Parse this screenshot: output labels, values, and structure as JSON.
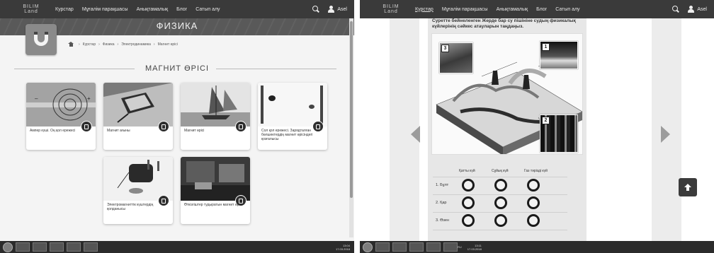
{
  "left": {
    "nav": {
      "logo_line1": "BILIM",
      "logo_line2": "Land",
      "links": [
        "Курстар",
        "Мұғалім парақшасы",
        "Анықтамалық",
        "Блог",
        "Сатып алу"
      ],
      "search_icon": "search-icon",
      "user_icon": "user-icon",
      "username": "Asel"
    },
    "banner_title": "ФИЗИКА",
    "subject_icon": "magnet-icon",
    "breadcrumb": [
      "Курстар",
      "Физика",
      "Электродинамика",
      "Магнит өрісі"
    ],
    "section_title": "МАГНИТ ӨРІСІ",
    "cards": [
      {
        "label": "Ампер күші. Оң қол ережесі",
        "image": "wire-coil-field"
      },
      {
        "label": "Магнит ағыны",
        "image": "frame-in-field"
      },
      {
        "label": "Магнит өрісі",
        "image": "sailboats"
      },
      {
        "label": "Сол қол ережесі. Зарядталған бөлшектердің магнит өрісіндегі қозғалысы",
        "image": "charged-particles"
      },
      {
        "label": "Электромагниттік күштердің қолданысы",
        "image": "electromagnet-device"
      },
      {
        "label": "Өткізгіштер тудыратын магнит өрісі",
        "image": "conductor-lab"
      }
    ]
  },
  "right": {
    "nav": {
      "logo_line1": "BILIM",
      "logo_line2": "Land",
      "links": [
        "Курстар",
        "Мұғалім парақшасы",
        "Анықтамалық",
        "Блог",
        "Сатып алу"
      ],
      "username": "Asel"
    },
    "question": "Суретте бейнеленген Жерде бар су пішініне судың физикалық күйлерінің сәйкес атауларын таңдаңыз.",
    "photo_numbers": [
      "1",
      "2",
      "3"
    ],
    "columns": [
      "Қатты күй",
      "Сұйық күй",
      "Газ тәріздi күй"
    ],
    "rows": [
      "1. Бұлт",
      "2. Қар",
      "3. Өзен"
    ],
    "up_icon": "arrow-up-icon"
  },
  "taskbar": {
    "time": "13:04",
    "date": "17.03.2018",
    "time_right": "13:11",
    "date_right": "17.03.2018",
    "lang": "RU"
  },
  "colors": {
    "nav_bg": "#3a3a3a",
    "banner_bg": "#595959",
    "taskbar_bg": "#2b2b2b",
    "circle": "#1a1a1a"
  }
}
